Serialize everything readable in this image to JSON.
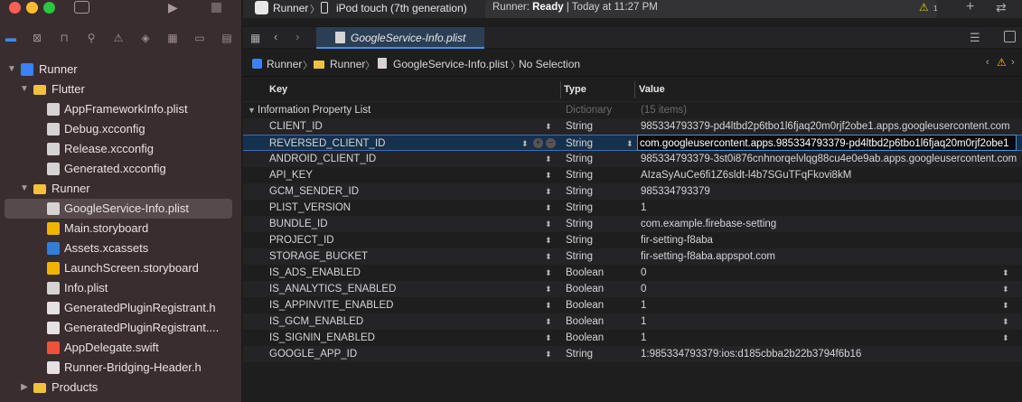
{
  "window": {
    "scheme": "Runner",
    "device": "iPod touch (7th generation)",
    "status_prefix": "Runner: ",
    "status_bold": "Ready",
    "status_suffix": " | Today at 11:27 PM",
    "warning_count": "1"
  },
  "sidebar": {
    "items": [
      {
        "label": "Runner",
        "kind": "project",
        "level": 0,
        "disclosure": "expanded"
      },
      {
        "label": "Flutter",
        "kind": "folder",
        "level": 1,
        "disclosure": "expanded"
      },
      {
        "label": "AppFrameworkInfo.plist",
        "kind": "file",
        "level": 2
      },
      {
        "label": "Debug.xcconfig",
        "kind": "file",
        "level": 2
      },
      {
        "label": "Release.xcconfig",
        "kind": "file",
        "level": 2
      },
      {
        "label": "Generated.xcconfig",
        "kind": "file",
        "level": 2
      },
      {
        "label": "Runner",
        "kind": "folder",
        "level": 1,
        "disclosure": "expanded"
      },
      {
        "label": "GoogleService-Info.plist",
        "kind": "file",
        "level": 2,
        "selected": true
      },
      {
        "label": "Main.storyboard",
        "kind": "file",
        "level": 2
      },
      {
        "label": "Assets.xcassets",
        "kind": "assets",
        "level": 2
      },
      {
        "label": "LaunchScreen.storyboard",
        "kind": "file",
        "level": 2
      },
      {
        "label": "Info.plist",
        "kind": "file",
        "level": 2
      },
      {
        "label": "GeneratedPluginRegistrant.h",
        "kind": "header",
        "level": 2
      },
      {
        "label": "GeneratedPluginRegistrant....",
        "kind": "file",
        "level": 2
      },
      {
        "label": "AppDelegate.swift",
        "kind": "swift",
        "level": 2
      },
      {
        "label": "Runner-Bridging-Header.h",
        "kind": "header",
        "level": 2
      },
      {
        "label": "Products",
        "kind": "folder",
        "level": 1,
        "disclosure": "collapsed"
      }
    ]
  },
  "editor": {
    "tab_title": "GoogleService-Info.plist",
    "breadcrumb": [
      "Runner",
      "Runner",
      "GoogleService-Info.plist",
      "No Selection"
    ]
  },
  "plist": {
    "columns": {
      "key": "Key",
      "type": "Type",
      "value": "Value"
    },
    "root": {
      "key": "Information Property List",
      "type": "Dictionary",
      "value": "(15 items)"
    },
    "rows": [
      {
        "key": "CLIENT_ID",
        "type": "String",
        "value": "985334793379-pd4ltbd2p6tbo1l6fjaq20m0rjf2obe1.apps.googleusercontent.com"
      },
      {
        "key": "REVERSED_CLIENT_ID",
        "type": "String",
        "value": "com.googleusercontent.apps.985334793379-pd4ltbd2p6tbo1l6fjaq20m0rjf2obe1",
        "selected": true
      },
      {
        "key": "ANDROID_CLIENT_ID",
        "type": "String",
        "value": "985334793379-3st0i876cnhnorqelvlqg88cu4e0e9ab.apps.googleusercontent.com"
      },
      {
        "key": "API_KEY",
        "type": "String",
        "value": "AIzaSyAuCe6fi1Z6sldt-l4b7SGuTFqFkovi8kM"
      },
      {
        "key": "GCM_SENDER_ID",
        "type": "String",
        "value": "985334793379"
      },
      {
        "key": "PLIST_VERSION",
        "type": "String",
        "value": "1"
      },
      {
        "key": "BUNDLE_ID",
        "type": "String",
        "value": "com.example.firebase-setting"
      },
      {
        "key": "PROJECT_ID",
        "type": "String",
        "value": "fir-setting-f8aba"
      },
      {
        "key": "STORAGE_BUCKET",
        "type": "String",
        "value": "fir-setting-f8aba.appspot.com"
      },
      {
        "key": "IS_ADS_ENABLED",
        "type": "Boolean",
        "value": "0"
      },
      {
        "key": "IS_ANALYTICS_ENABLED",
        "type": "Boolean",
        "value": "0"
      },
      {
        "key": "IS_APPINVITE_ENABLED",
        "type": "Boolean",
        "value": "1"
      },
      {
        "key": "IS_GCM_ENABLED",
        "type": "Boolean",
        "value": "1"
      },
      {
        "key": "IS_SIGNIN_ENABLED",
        "type": "Boolean",
        "value": "1"
      },
      {
        "key": "GOOGLE_APP_ID",
        "type": "String",
        "value": "1:985334793379:ios:d185cbba2b22b3794f6b16"
      }
    ]
  },
  "colors": {
    "accent": "#4a90e2",
    "sidebar_bg": "#3a2d30",
    "warning": "#f5c400"
  }
}
